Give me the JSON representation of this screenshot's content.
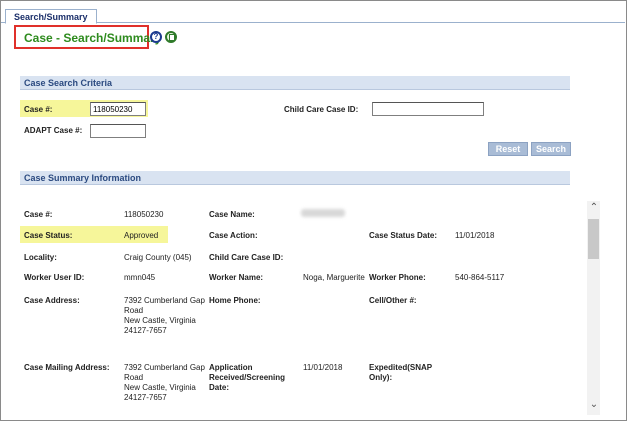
{
  "tabs": [
    {
      "label": "Search/Summary"
    }
  ],
  "page": {
    "title": "Case - Search/Summary",
    "help_icon_glyph": "?"
  },
  "search_criteria": {
    "header": "Case Search Criteria",
    "case_number_label": "Case #:",
    "case_number_value": "118050230",
    "adapt_case_label": "ADAPT Case #:",
    "adapt_case_value": "",
    "child_care_case_label": "Child Care Case ID:",
    "child_care_case_value": "",
    "reset_label": "Reset",
    "search_label": "Search"
  },
  "summary": {
    "header": "Case Summary Information",
    "case_number_label": "Case #:",
    "case_number_value": "118050230",
    "case_name_label": "Case Name:",
    "case_status_label": "Case Status:",
    "case_status_value": "Approved",
    "case_action_label": "Case Action:",
    "case_status_date_label": "Case Status Date:",
    "case_status_date_value": "11/01/2018",
    "locality_label": "Locality:",
    "locality_value": "Craig County (045)",
    "child_care_case_label": "Child Care Case ID:",
    "worker_user_label": "Worker User ID:",
    "worker_user_value": "mmn045",
    "worker_name_label": "Worker Name:",
    "worker_name_value": "Noga, Marguerite",
    "worker_phone_label": "Worker Phone:",
    "worker_phone_value": "540-864-5117",
    "case_address_label": "Case Address:",
    "case_address_lines": [
      "7392 Cumberland Gap",
      "Road",
      "New Castle, Virginia",
      "24127-7657"
    ],
    "home_phone_label": "Home Phone:",
    "cell_other_label": "Cell/Other #:",
    "mailing_address_label": "Case Mailing Address:",
    "mailing_address_lines": [
      "7392 Cumberland Gap",
      "Road",
      "New Castle, Virginia",
      "24127-7657"
    ],
    "application_label_lines": [
      "Application",
      "Received/Screening",
      "Date:"
    ],
    "application_date_value": "11/01/2018",
    "expedited_label_lines": [
      "Expedited(SNAP",
      "Only):"
    ]
  },
  "colors": {
    "title_green": "#2e8b1e",
    "highlight_yellow": "#f6f69a",
    "annotation_red": "#e0302a",
    "section_blue": "#d9e3f1"
  },
  "icons": [
    "help-icon",
    "document-icon",
    "scroll-up-arrow-icon",
    "scroll-down-arrow-icon"
  ]
}
